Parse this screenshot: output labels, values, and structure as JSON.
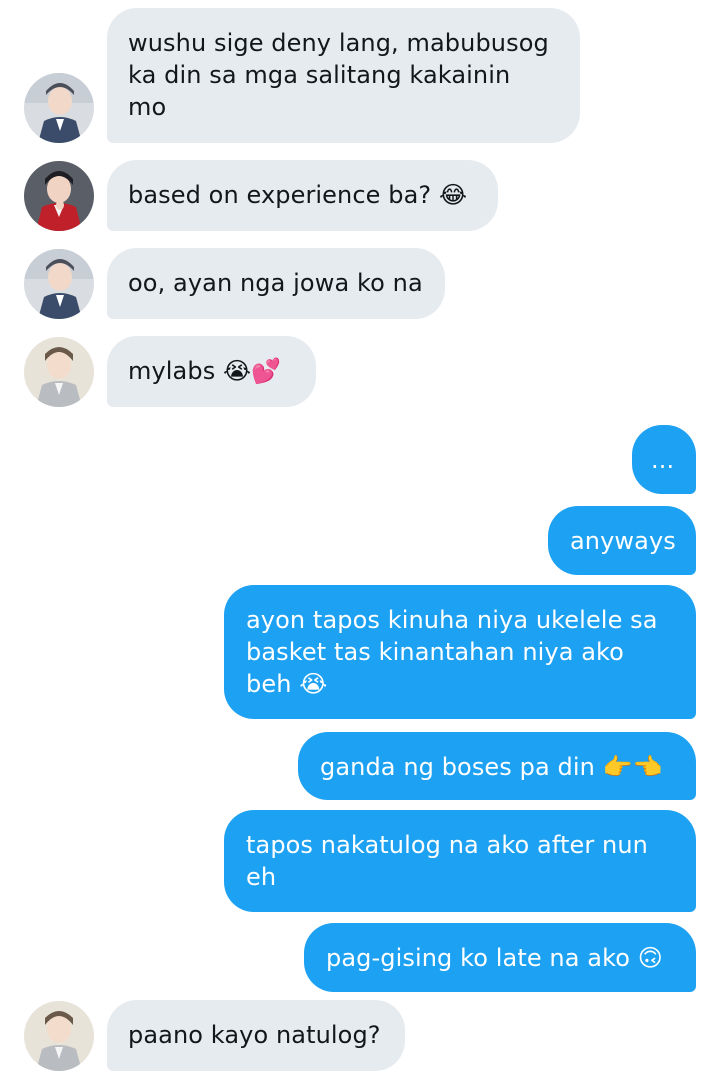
{
  "conversation": {
    "messages": [
      {
        "direction": "incoming",
        "text": "wushu sige deny lang, mabubusog\nka din sa mga salitang kakainin\nmo",
        "avatar": "avatar-blue-suit"
      },
      {
        "direction": "incoming",
        "text": "based on experience ba? 😂",
        "avatar": "avatar-red-jacket"
      },
      {
        "direction": "incoming",
        "text": "oo, ayan nga jowa ko na",
        "avatar": "avatar-blue-suit"
      },
      {
        "direction": "incoming",
        "text": "mylabs 😭💕",
        "avatar": "avatar-grey-suit"
      },
      {
        "direction": "outgoing",
        "text": "..."
      },
      {
        "direction": "outgoing",
        "text": "anyways"
      },
      {
        "direction": "outgoing",
        "text": "ayon tapos kinuha niya ukelele sa\nbasket tas kinantahan niya ako\nbeh 😭"
      },
      {
        "direction": "outgoing",
        "text": "ganda ng boses pa din 👉👈"
      },
      {
        "direction": "outgoing",
        "text": "tapos nakatulog na ako after nun\neh"
      },
      {
        "direction": "outgoing",
        "text": "pag-gising ko late na ako 🙃"
      },
      {
        "direction": "incoming",
        "text": "paano kayo natulog?",
        "avatar": "avatar-grey-suit"
      }
    ]
  },
  "colors": {
    "incoming_bubble": "#e6ebf0",
    "incoming_text": "#14171a",
    "outgoing_bubble": "#1da1f2",
    "outgoing_text": "#ffffff"
  }
}
